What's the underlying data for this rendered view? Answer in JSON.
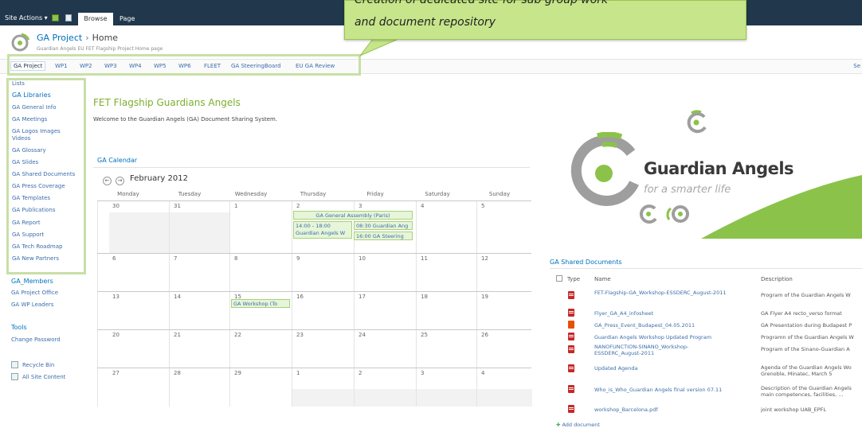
{
  "ribbon": {
    "site_actions": "Site Actions ▾",
    "tab_browse": "Browse",
    "tab_page": "Page"
  },
  "title": {
    "site": "GA Project",
    "sep": "›",
    "page": "Home",
    "description": "Guardian Angels EU FET Flagship Project Home page"
  },
  "topnav": [
    "GA Project",
    "WP1",
    "WP2",
    "WP3",
    "WP4",
    "WP5",
    "WP6",
    "FLEET",
    "GA SteeringBoard",
    "EU GA Review"
  ],
  "topnav_right": "Se",
  "callout": {
    "line1": "Creation of dedicated site for sub group work",
    "line2": "and document repository"
  },
  "leftnav": {
    "lists": "Lists",
    "libraries_heading": "GA Libraries",
    "items": [
      "GA General Info",
      "GA Meetings",
      "GA Logos Images",
      "Videos",
      "GA Glossary",
      "GA Slides",
      "GA Shared Documents",
      "GA Press Coverage",
      "GA Templates",
      "GA Publications",
      "GA Report",
      "GA Support",
      "GA Tech Roadmap",
      "GA New Partners"
    ],
    "members_heading": "GA_Members",
    "members": [
      "GA Project Office",
      "GA WP Leaders"
    ],
    "tools_heading": "Tools",
    "tools": [
      "Change Password"
    ],
    "quick": [
      "Recycle Bin",
      "All Site Content"
    ]
  },
  "main": {
    "title": "FET Flagship Guardians Angels",
    "welcome": "Welcome to the Guardian Angels (GA) Document Sharing System."
  },
  "calendar": {
    "title": "GA Calendar",
    "prev": "←",
    "next": "→",
    "month": "February 2012",
    "days": [
      "Monday",
      "Tuesday",
      "Wednesday",
      "Thursday",
      "Friday",
      "Saturday",
      "Sunday"
    ],
    "weeks": [
      [
        "30",
        "31",
        "1",
        "2",
        "3",
        "4",
        "5"
      ],
      [
        "6",
        "7",
        "8",
        "9",
        "10",
        "11",
        "12"
      ],
      [
        "13",
        "14",
        "15",
        "16",
        "17",
        "18",
        "19"
      ],
      [
        "20",
        "21",
        "22",
        "23",
        "24",
        "25",
        "26"
      ],
      [
        "27",
        "28",
        "29",
        "1",
        "2",
        "3",
        "4"
      ]
    ],
    "events": {
      "assembly": "GA General Assembly (Paris)",
      "thu_time": "14:00 - 18:00",
      "thu_name": "Guardian Angels W",
      "fri_1": "08:30 Guardian Ang",
      "fri_2": "16:00 GA Steering",
      "workshop": "GA Workshop (To"
    }
  },
  "brand": {
    "name": "Guardian Angels",
    "tagline": "for a smarter life"
  },
  "shared_docs": {
    "title": "GA Shared Documents",
    "col_type": "Type",
    "col_name": "Name",
    "col_desc": "Description",
    "rows": [
      {
        "type": "pdf",
        "name": "FET-Flagship-GA_Workshop-ESSDERC_August-2011",
        "desc": "Program of the Guardian Angels W"
      },
      {
        "type": "pdf",
        "name": "Flyer_GA_A4_infosheet",
        "desc": "GA Flyer A4 recto_verso format"
      },
      {
        "type": "ppt",
        "name": "GA_Press_Event_Budapest_04.05.2011",
        "desc": "GA Presentation during Budapest P"
      },
      {
        "type": "pdf",
        "name": "Guardian Angels Workshop Updated Program",
        "desc": "Programn of the Guardian Angels W"
      },
      {
        "type": "pdf",
        "name": "NANOFUNCTION-SINANO_Workshop-ESSDERC_August-2011",
        "desc": "Program of the Sinano-Guardian A"
      },
      {
        "type": "pdf",
        "name": "Updated Agenda",
        "desc": "Agenda of the Guardian Angels Wo",
        "desc2": "Grenoble, Minatec, March 5"
      },
      {
        "type": "pdf",
        "name": "Who_is_Who_Guardian Angels final version 07.11",
        "desc": "Description of the Guardian Angels",
        "desc2": "main competences, facilities, ..."
      },
      {
        "type": "pdf",
        "name": "workshop_Barcelona.pdf",
        "desc": "joint workshop UAB_EPFL"
      }
    ],
    "add": "Add document"
  },
  "colors": {
    "ribbon": "#21374c",
    "link": "#3b6dab",
    "accent": "#7caf2f",
    "callout": "#c7e58b"
  }
}
